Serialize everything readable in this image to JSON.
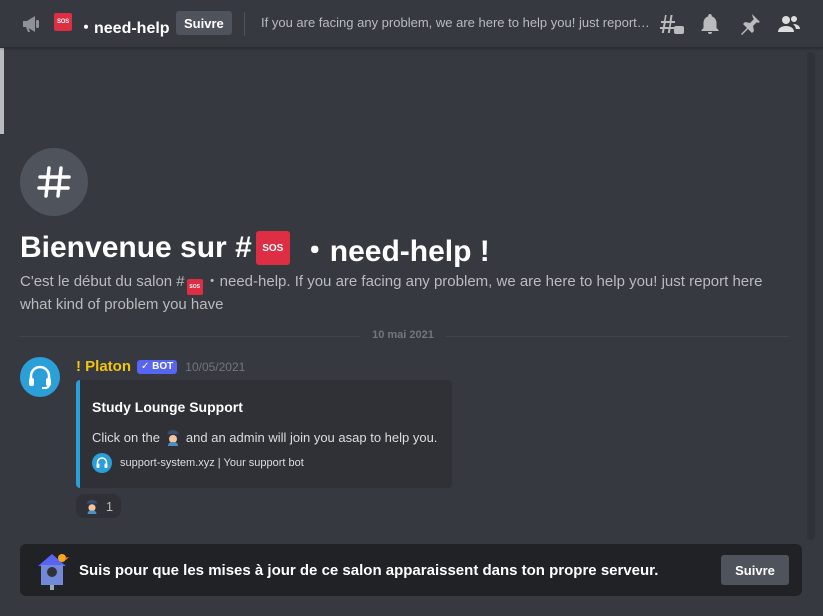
{
  "header": {
    "channel_emoji_text": "SOS",
    "channel_name": "・need-help",
    "follow_label": "Suivre",
    "topic": "If you are facing any problem, we are here to help you! just report here what kind of problem you have",
    "icons": [
      "threads-icon",
      "bell-icon",
      "pin-icon",
      "members-icon"
    ]
  },
  "welcome": {
    "title_prefix": "Bienvenue sur #",
    "title_suffix": "・need-help !",
    "emoji_text": "SOS",
    "desc_prefix": "C'est le début du salon #",
    "desc_suffix": "・need-help. If you are facing any problem, we are here to help you! just report here what kind of problem you have"
  },
  "date_divider": "10 mai 2021",
  "message": {
    "author": "! Platon",
    "bot_tag": "✓ BOT",
    "timestamp": "10/05/2021",
    "embed": {
      "title": "Study Lounge Support",
      "desc_before": "Click on the",
      "desc_after": "and an admin will join you asap to help you.",
      "footer": "support-system.xyz | Your support bot",
      "accent_color": "#2a9fd8"
    },
    "reaction_count": "1"
  },
  "follow_bar": {
    "text": "Suis pour que les mises à jour de ce salon apparaissent dans ton propre serveur.",
    "button_label": "Suivre"
  },
  "colors": {
    "background": "#36393f",
    "accent_blue": "#2a9fd8",
    "bot_tag": "#5865f2",
    "author": "#f1c40f",
    "sos_red": "#dd2e44"
  }
}
